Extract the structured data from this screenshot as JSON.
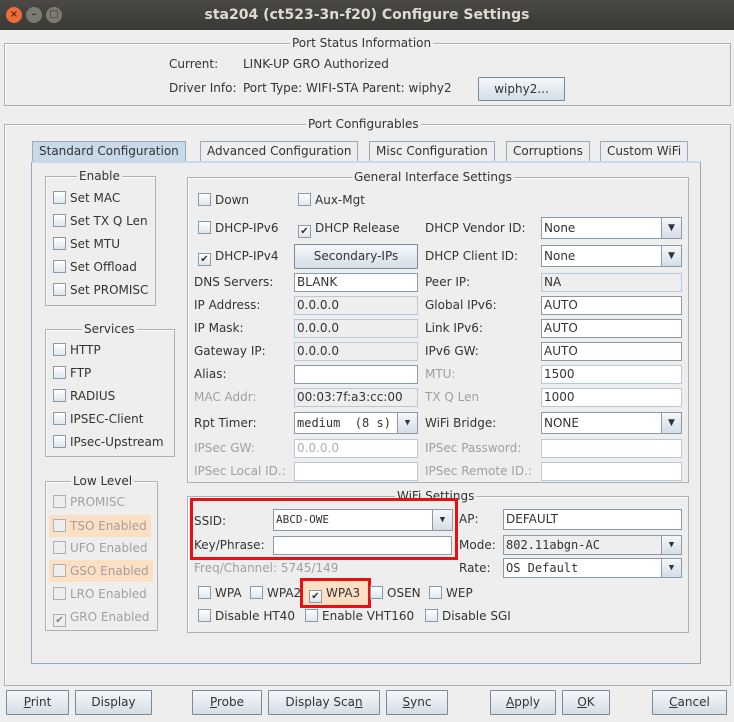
{
  "window": {
    "title": "sta204  (ct523-3n-f20) Configure Settings"
  },
  "status": {
    "title": "Port Status Information",
    "current_label": "Current:",
    "current_value": "LINK-UP GRO  Authorized",
    "driver_label": "Driver Info:",
    "driver_value": "Port Type: WIFI-STA   Parent: wiphy2",
    "parent_button": "wiphy2..."
  },
  "configurables": {
    "title": "Port Configurables"
  },
  "tabs": [
    "Standard Configuration",
    "Advanced Configuration",
    "Misc Configuration",
    "Corruptions",
    "Custom WiFi"
  ],
  "enable": {
    "title": "Enable",
    "items": [
      "Set MAC",
      "Set TX Q Len",
      "Set MTU",
      "Set Offload",
      "Set PROMISC"
    ]
  },
  "services": {
    "title": "Services",
    "items": [
      "HTTP",
      "FTP",
      "RADIUS",
      "IPSEC-Client",
      "IPsec-Upstream"
    ]
  },
  "lowlevel": {
    "title": "Low Level",
    "items": [
      {
        "label": "PROMISC",
        "checked": false,
        "highlight": false
      },
      {
        "label": "TSO Enabled",
        "checked": false,
        "highlight": true
      },
      {
        "label": "UFO Enabled",
        "checked": false,
        "highlight": false
      },
      {
        "label": "GSO Enabled",
        "checked": false,
        "highlight": true
      },
      {
        "label": "LRO Enabled",
        "checked": false,
        "highlight": false
      },
      {
        "label": "GRO Enabled",
        "checked": true,
        "highlight": false
      }
    ]
  },
  "general": {
    "title": "General Interface Settings",
    "down": "Down",
    "auxmgt": "Aux-Mgt",
    "dhcp6": "DHCP-IPv6",
    "dhcprel": "DHCP Release",
    "dhcp4": "DHCP-IPv4",
    "secondary": "Secondary-IPs",
    "dns_label": "DNS Servers:",
    "dns": "BLANK",
    "ip_label": "IP Address:",
    "ip": "0.0.0.0",
    "mask_label": "IP Mask:",
    "mask": "0.0.0.0",
    "gw_label": "Gateway IP:",
    "gw": "0.0.0.0",
    "alias_label": "Alias:",
    "alias": "",
    "mac_label": "MAC Addr:",
    "mac": "00:03:7f:a3:cc:00",
    "rpt_label": "Rpt Timer:",
    "rpt": "medium  (8 s)",
    "ipsecgw_label": "IPSec GW:",
    "ipsecgw": "0.0.0.0",
    "ipseclocal_label": "IPSec Local ID.:",
    "ipseclocal": "",
    "vendor_label": "DHCP Vendor ID:",
    "vendor": "None",
    "client_label": "DHCP Client ID:",
    "client": "None",
    "peer_label": "Peer IP:",
    "peer": "NA",
    "gipv6_label": "Global IPv6:",
    "gipv6": "AUTO",
    "lipv6_label": "Link IPv6:",
    "lipv6": "AUTO",
    "ipv6gw_label": "IPv6 GW:",
    "ipv6gw": "AUTO",
    "mtu_label": "MTU:",
    "mtu": "1500",
    "txq_label": "TX Q Len",
    "txq": "1000",
    "bridge_label": "WiFi Bridge:",
    "bridge": "NONE",
    "ipsecpw_label": "IPSec Password:",
    "ipsecpw": "",
    "ipsecremote_label": "IPSec Remote ID.:",
    "ipsecremote": ""
  },
  "wifi": {
    "title": "WiFi Settings",
    "ssid_label": "SSID:",
    "ssid": "ABCD-OWE",
    "key_label": "Key/Phrase:",
    "key": "",
    "freq": "Freq/Channel: 5745/149",
    "ap_label": "AP:",
    "ap": "DEFAULT",
    "mode_label": "Mode:",
    "mode": "802.11abgn-AC",
    "rate_label": "Rate:",
    "rate": "OS Default",
    "wpa": "WPA",
    "wpa2": "WPA2",
    "wpa3": "WPA3",
    "osen": "OSEN",
    "wep": "WEP",
    "ht40": "Disable HT40",
    "vht160": "Enable VHT160",
    "sgi": "Disable SGI",
    "highlight_color": "#e81010"
  },
  "buttons": {
    "print": "Print",
    "display": "Display",
    "probe": "Probe",
    "scan": "Display Scan",
    "sync": "Sync",
    "apply": "Apply",
    "ok": "OK",
    "cancel": "Cancel"
  }
}
